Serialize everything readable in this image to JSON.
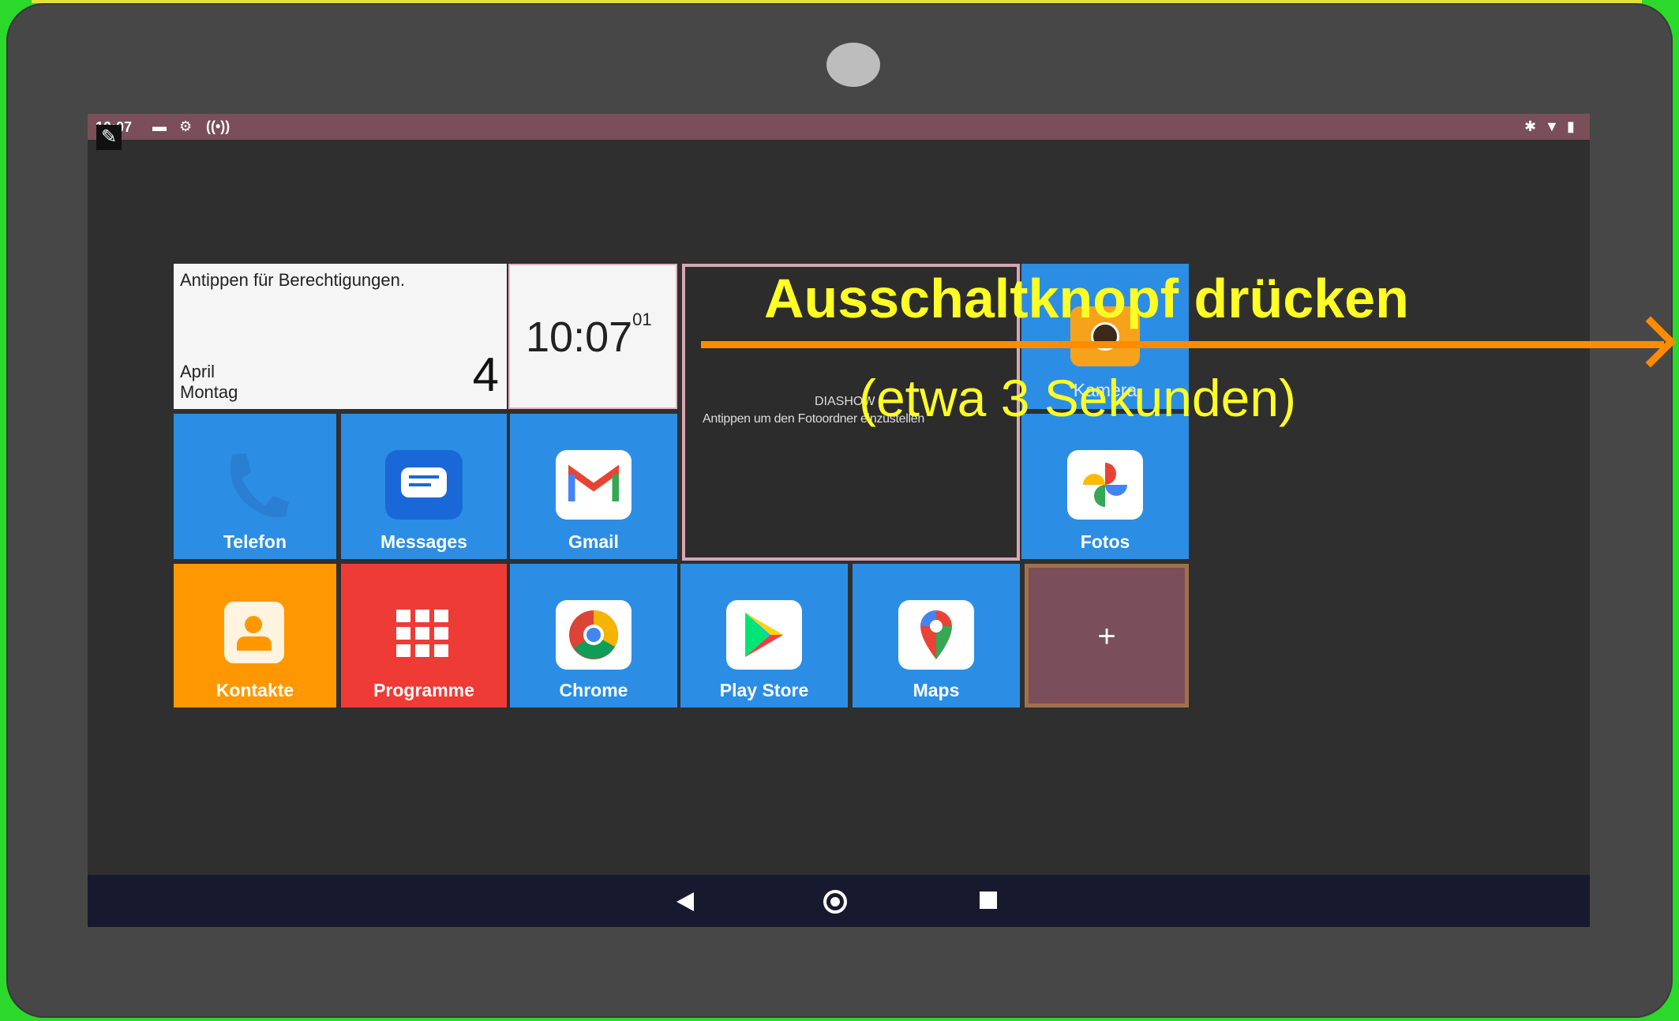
{
  "statusbar": {
    "time": "10:07"
  },
  "calendar": {
    "hint": "Antippen für Berechtigungen.",
    "month": "April",
    "weekday": "Montag",
    "day": "4"
  },
  "clock": {
    "time": "10:07",
    "seconds": "01"
  },
  "slideshow": {
    "title": "DIASHOW",
    "hint": "Antippen um den Fotoordner einzustellen"
  },
  "apps": {
    "kamera": "Kamera",
    "telefon": "Telefon",
    "messages": "Messages",
    "gmail": "Gmail",
    "fotos": "Fotos",
    "kontakte": "Kontakte",
    "programme": "Programme",
    "chrome": "Chrome",
    "playstore": "Play Store",
    "maps": "Maps"
  },
  "add_tile": {
    "symbol": "+"
  },
  "overlay": {
    "title": "Ausschaltknopf drücken",
    "subtitle": "(etwa 3 Sekunden)"
  },
  "colors": {
    "tile_blue": "#2b8ee4",
    "kontakte_orange": "#ff9800",
    "programme_red": "#ef3b36",
    "statusbar": "#7a4e5b",
    "annotation_yellow": "#ffff26",
    "arrow_orange": "#ff8c00"
  }
}
